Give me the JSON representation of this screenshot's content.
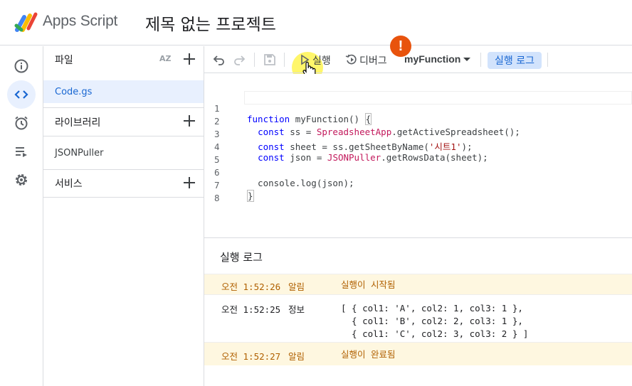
{
  "header": {
    "app_name": "Apps Script",
    "project_title": "제목 없는 프로젝트"
  },
  "rail": {
    "items": [
      "info-icon",
      "code-icon",
      "alarm-icon",
      "executions-icon",
      "settings-icon"
    ],
    "active": "code-icon"
  },
  "files_panel": {
    "title": "파일",
    "sort_label": "AZ",
    "files": [
      {
        "name": "Code.gs",
        "active": true
      }
    ],
    "libraries_title": "라이브러리",
    "libraries": [
      {
        "name": "JSONPuller"
      }
    ],
    "services_title": "서비스"
  },
  "toolbar": {
    "run_label": "실행",
    "debug_label": "디버그",
    "function_select": "myFunction",
    "exec_log_label": "실행 로그",
    "warning_badge": "!"
  },
  "editor": {
    "lines": [
      {
        "n": "1",
        "text": "function myFunction() {"
      },
      {
        "n": "2",
        "text": "  const ss = SpreadsheetApp.getActiveSpreadsheet();"
      },
      {
        "n": "3",
        "text": "  const sheet = ss.getSheetByName('시트1');"
      },
      {
        "n": "4",
        "text": "  const json = JSONPuller.getRowsData(sheet);"
      },
      {
        "n": "5",
        "text": ""
      },
      {
        "n": "6",
        "text": "  console.log(json);"
      },
      {
        "n": "7",
        "text": "}"
      },
      {
        "n": "8",
        "text": ""
      }
    ]
  },
  "log": {
    "title": "실행 로그",
    "rows": [
      {
        "time": "오전 1:52:26",
        "level": "알림",
        "message": "실행이 시작됨",
        "type": "notice"
      },
      {
        "time": "오전 1:52:25",
        "level": "정보",
        "message": "[ { col1: 'A', col2: 1, col3: 1 },\n  { col1: 'B', col2: 2, col3: 1 },\n  { col1: 'C', col2: 3, col3: 2 } ]",
        "type": "info"
      },
      {
        "time": "오전 1:52:27",
        "level": "알림",
        "message": "실행이 완료됨",
        "type": "notice"
      }
    ]
  },
  "colors": {
    "accent": "#1967d2",
    "active_bg": "#e8f0fe",
    "notice_bg": "#fef7e0",
    "warning": "#e8530d",
    "highlight": "#fff550"
  }
}
